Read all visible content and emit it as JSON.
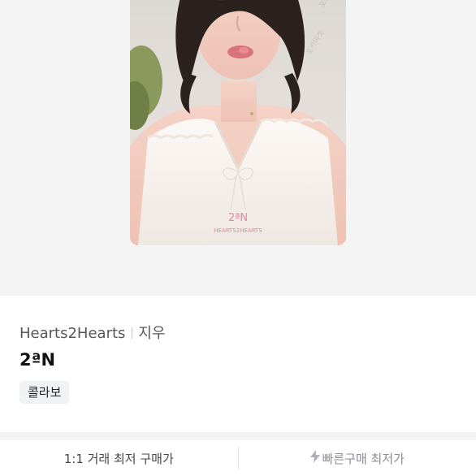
{
  "product": {
    "artist": "Hearts2Hearts",
    "member": "지우",
    "title": "2ªN",
    "tag": "콜라보"
  },
  "photo": {
    "subject": "photocard-image",
    "caption_lines": [
      "2ªN",
      "HEARTS2HEARTS"
    ]
  },
  "price_tabs": {
    "direct_label": "1:1 거래 최저 구매가",
    "quick_label": "빠른구매 최저가",
    "quick_icon": "lightning-bolt-icon"
  },
  "colors": {
    "background_gray": "#f4f4f5",
    "text_primary": "#111111",
    "text_secondary": "#55575c",
    "tag_background": "#f1f2f4",
    "quick_tab_text": "#8a8d93"
  }
}
